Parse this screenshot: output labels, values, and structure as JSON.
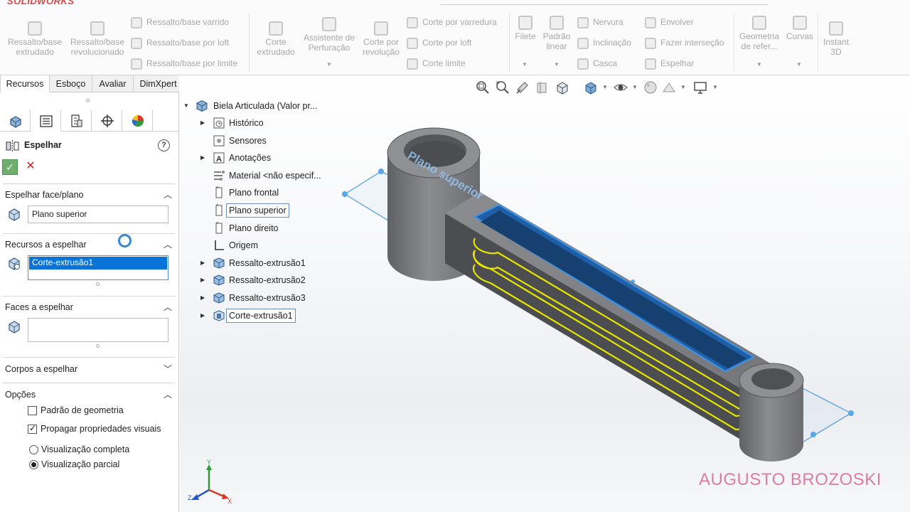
{
  "app": {
    "logo_text": "SOLIDWORKS"
  },
  "ribbon": {
    "big_buttons": [
      {
        "id": "extruded-boss",
        "label": "Ressalto/base\nextrudado"
      },
      {
        "id": "revolved-boss",
        "label": "Ressalto/base\nrevolucionado"
      },
      {
        "id": "extruded-cut",
        "label": "Corte\nextrudado"
      },
      {
        "id": "hole-wizard",
        "label": "Assistente de\nPerfuração"
      },
      {
        "id": "revolved-cut",
        "label": "Corte por\nrevolução"
      },
      {
        "id": "fillet",
        "label": "Filete"
      },
      {
        "id": "linear-pattern",
        "label": "Padrão\nlinear"
      },
      {
        "id": "reference-geometry",
        "label": "Geometria\nde refer..."
      },
      {
        "id": "curves",
        "label": "Curvas"
      },
      {
        "id": "instant3d",
        "label": "Instant\n3D"
      }
    ],
    "small_buttons": {
      "swept_boss": "Ressalto/base varrido",
      "lofted_boss": "Ressalto/base por loft",
      "boundary_boss": "Ressalto/base por limite",
      "swept_cut": "Corte por varredura",
      "lofted_cut": "Corte por loft",
      "boundary_cut": "Corte limite",
      "rib": "Nervura",
      "draft": "Inclinação",
      "shell": "Casca",
      "wrap": "Envolver",
      "intersect": "Fazer interseção",
      "mirror": "Espelhar"
    }
  },
  "manager_tabs": [
    "Recursos",
    "Esboço",
    "Avaliar",
    "DimXpert"
  ],
  "property_manager": {
    "title": "Espelhar",
    "help_label": "?",
    "ok_label": "✓",
    "cancel_label": "✕",
    "sections": {
      "mirror_plane": {
        "label": "Espelhar face/plano",
        "value": "Plano superior"
      },
      "features": {
        "label": "Recursos a espelhar",
        "selected": "Corte-extrusão1"
      },
      "faces": {
        "label": "Faces a espelhar"
      },
      "bodies": {
        "label": "Corpos a espelhar"
      },
      "options": {
        "label": "Opções",
        "geometry_pattern": "Padrão de geometria",
        "propagate_visual": "Propagar propriedades visuais",
        "full_preview": "Visualização completa",
        "partial_preview": "Visualização parcial"
      }
    },
    "state": {
      "geometry_pattern_checked": false,
      "propagate_visual_checked": true,
      "preview_mode": "partial"
    }
  },
  "feature_tree": {
    "root": "Biela Articulada  (Valor pr...",
    "items": [
      {
        "label": "Histórico",
        "expandable": true,
        "icon": "history-icon"
      },
      {
        "label": "Sensores",
        "expandable": false,
        "icon": "sensor-icon"
      },
      {
        "label": "Anotações",
        "expandable": true,
        "icon": "annotation-icon"
      },
      {
        "label": "Material <não especif...",
        "expandable": false,
        "icon": "material-icon"
      },
      {
        "label": "Plano frontal",
        "expandable": false,
        "icon": "plane-icon"
      },
      {
        "label": "Plano superior",
        "expandable": false,
        "icon": "plane-icon",
        "highlighted": true
      },
      {
        "label": "Plano direito",
        "expandable": false,
        "icon": "plane-icon"
      },
      {
        "label": "Origem",
        "expandable": false,
        "icon": "origin-icon"
      },
      {
        "label": "Ressalto-extrusão1",
        "expandable": true,
        "icon": "boss-extrude-icon"
      },
      {
        "label": "Ressalto-extrusão2",
        "expandable": true,
        "icon": "boss-extrude-icon"
      },
      {
        "label": "Ressalto-extrusão3",
        "expandable": true,
        "icon": "boss-extrude-icon"
      },
      {
        "label": "Corte-extrusão1",
        "expandable": true,
        "icon": "cut-extrude-icon",
        "highlighted": true
      }
    ]
  },
  "viewport": {
    "plane_label": "Plano superior",
    "watermark": "AUGUSTO BROZOSKI",
    "triad": {
      "x": "X",
      "y": "Y",
      "z": "Z"
    },
    "colors": {
      "selection": "#2f8fe0",
      "preview": "#e6e600",
      "body": "#7d7f83"
    }
  }
}
